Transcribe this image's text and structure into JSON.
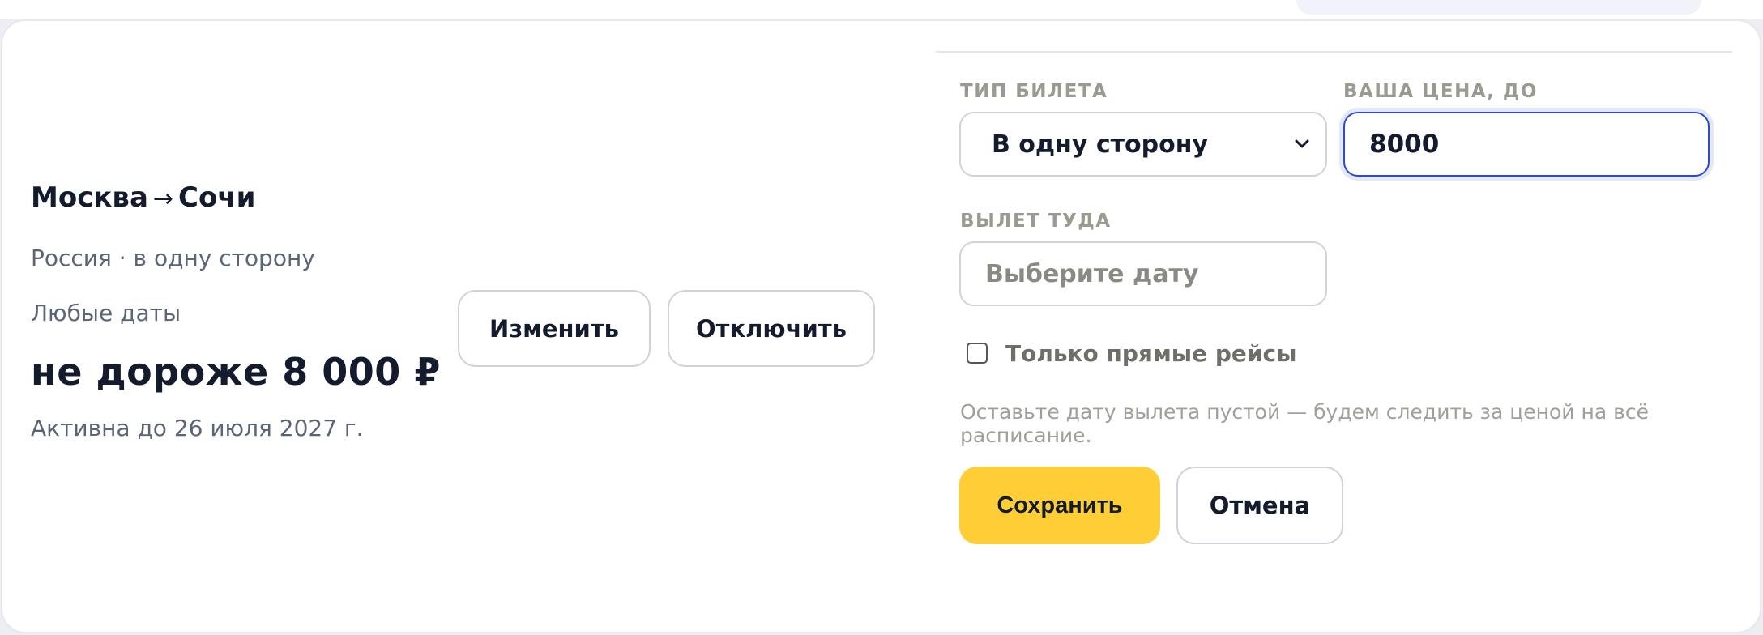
{
  "route": {
    "from": "Москва",
    "arrow": "→",
    "to": "Сочи"
  },
  "subtitle": "Россия · в одну сторону",
  "dates": "Любые даты",
  "price_line": "не дороже 8 000 ₽",
  "active_until": "Активна до 26 июля 2027 г.",
  "actions": {
    "edit": "Изменить",
    "disable": "Отключить"
  },
  "form": {
    "ticket_type_label": "ТИП БИЛЕТА",
    "ticket_type_value": "В одну сторону",
    "price_label": "ВАША ЦЕНА, ДО",
    "price_value": "8000",
    "depart_label": "ВЫЛЕТ ТУДА",
    "depart_placeholder": "Выберите дату",
    "direct_only_label": "Только прямые рейсы",
    "direct_only_checked": false,
    "hint": "Оставьте дату вылета пустой — будем следить за ценой на всё расписание.",
    "save": "Сохранить",
    "cancel": "Отмена"
  },
  "colors": {
    "accent_yellow": "#ffcd36",
    "focus_blue": "#2a49d8",
    "text_dark": "#141b2d"
  }
}
